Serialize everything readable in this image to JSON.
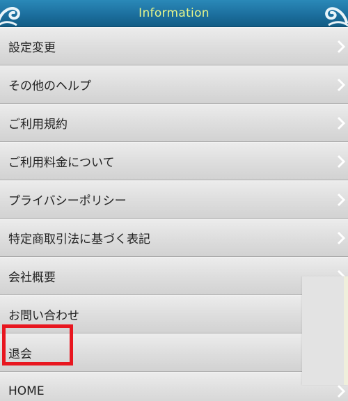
{
  "header": {
    "title": "Information"
  },
  "menu": {
    "items": [
      {
        "label": "設定変更"
      },
      {
        "label": "その他のヘルプ"
      },
      {
        "label": "ご利用規約"
      },
      {
        "label": "ご利用料金について"
      },
      {
        "label": "プライバシーポリシー"
      },
      {
        "label": "特定商取引法に基づく表記"
      },
      {
        "label": "会社概要"
      },
      {
        "label": "お問い合わせ"
      },
      {
        "label": "退会"
      },
      {
        "label": "HOME"
      }
    ]
  },
  "icons": {
    "header_decor": "wave-decoration-icon",
    "row_arrow": "chevron-right-icon"
  },
  "colors": {
    "header_bg": "#1c6f9e",
    "header_title": "#e6f58a",
    "highlight": "#e8161f"
  }
}
